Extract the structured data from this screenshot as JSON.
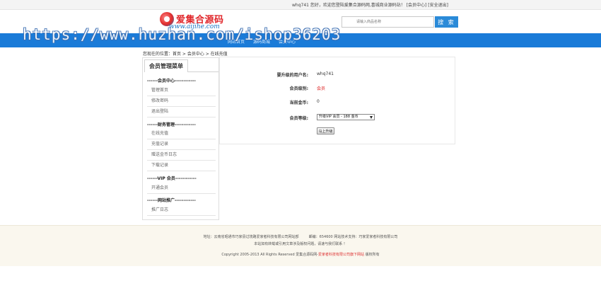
{
  "topbar": {
    "welcome": "whq741 您好，欢迎您登陆爱集合源码网,喜城商业源码站！",
    "member_center": "会员中心",
    "logout": "安全退出"
  },
  "logo": {
    "cn": "爱集合源码",
    "en": "www.aijihe.com"
  },
  "search": {
    "placeholder": "请输入商品名称",
    "button": "搜 索"
  },
  "nav": {
    "items": [
      "网站首页",
      "源码商城",
      "会员中心"
    ]
  },
  "watermark": "https://www.huzhan.com/ishop36203",
  "breadcrumb": "您现在的位置：首页 > 会员中心 > 在线充值",
  "sidebar": {
    "title": "会员管理菜单",
    "sections": [
      {
        "label": "------会员中心------------",
        "items": [
          "管理首页",
          "修改密码",
          "退出登陆"
        ]
      },
      {
        "label": "------财务管理------------",
        "items": [
          "在线充值",
          "充值记录",
          "赠送金币日志",
          "下载记录"
        ]
      },
      {
        "label": "------VIP 会员------------",
        "items": [
          "开通会员"
        ]
      },
      {
        "label": "------网站推广------------",
        "items": [
          "推广日志"
        ]
      }
    ]
  },
  "upgrade": {
    "username_label": "要升级的用户名:",
    "username": "whq741",
    "level_label": "会员级别:",
    "level": "会员",
    "coins_label": "当前金币:",
    "coins": "0",
    "grade_label": "会员等级:",
    "grade_selected": "升级VIP 会员 - 188 金币",
    "submit": "马上升级"
  },
  "footer": {
    "address": "地址：云南省昭通市巧家县过境路爱家者科技有限公司网站部",
    "postcode": "邮编：654600 网站技术支持：巧家爱家者科技有限公司",
    "notice": "本站如有转载或引用文章涉及版权问题，请速与我们联系 ！",
    "copyright_prefix": "Copyright 2005-2013 All Rights Reserved 爱集合源码网-",
    "copyright_company": "爱家者科技有限公司旗下网站",
    "copyright_suffix": " 版权所有"
  },
  "colors": {
    "accent": "#1a7bd8",
    "logo_red": "#e0262a",
    "level_red": "#dd2222"
  }
}
